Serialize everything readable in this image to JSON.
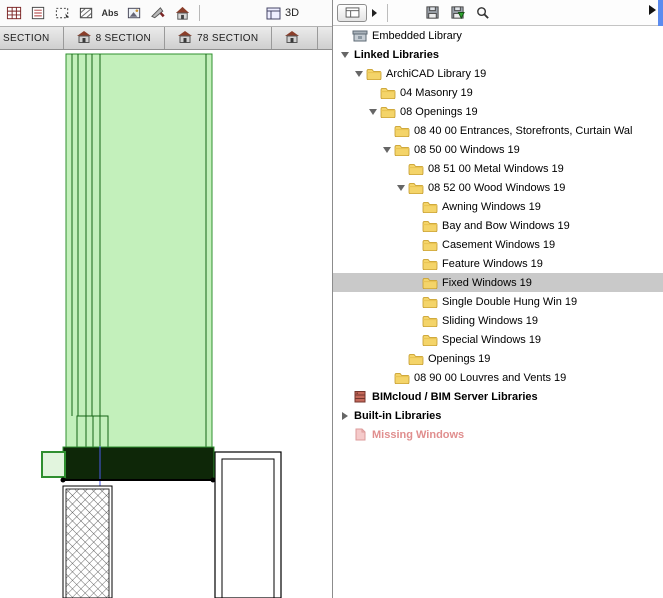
{
  "toolbar": {
    "icons": [
      {
        "name": "schedule-icon",
        "glyph": "schedule"
      },
      {
        "name": "project-index-icon",
        "glyph": "index"
      },
      {
        "name": "marquee-icon",
        "glyph": "marquee"
      },
      {
        "name": "fill-icon",
        "glyph": "fill"
      },
      {
        "name": "dimension-abs-icon",
        "glyph": "abs",
        "label": "Abs"
      },
      {
        "name": "figure-icon",
        "glyph": "figure"
      },
      {
        "name": "split-knife-icon",
        "glyph": "knife"
      },
      {
        "name": "elevation-tool-icon",
        "glyph": "house"
      }
    ],
    "view3d_label": "3D"
  },
  "tabs": [
    {
      "label": "SECTION",
      "icon": false
    },
    {
      "label": "8 SECTION",
      "icon": true
    },
    {
      "label": "78 SECTION",
      "icon": true
    },
    {
      "label": "",
      "icon": true
    }
  ],
  "library_panel": {
    "tree": {
      "selected_item": "Fixed Windows 19",
      "missing_color": "#e08e8e",
      "rows": [
        {
          "level": 0,
          "disclosure": null,
          "icon": "embedded",
          "label": "Embedded Library",
          "bold": false
        },
        {
          "level": 0,
          "disclosure": "open",
          "icon": null,
          "label": "Linked Libraries",
          "bold": true
        },
        {
          "level": 1,
          "disclosure": "open",
          "icon": "folder",
          "label": "ArchiCAD Library 19",
          "bold": false
        },
        {
          "level": 2,
          "disclosure": null,
          "icon": "folder",
          "label": "04 Masonry 19",
          "bold": false
        },
        {
          "level": 2,
          "disclosure": "open",
          "icon": "folder",
          "label": "08 Openings 19",
          "bold": false
        },
        {
          "level": 3,
          "disclosure": null,
          "icon": "folder",
          "label": "08 40 00 Entrances, Storefronts, Curtain Wal",
          "bold": false
        },
        {
          "level": 3,
          "disclosure": "open",
          "icon": "folder",
          "label": "08 50 00 Windows 19",
          "bold": false
        },
        {
          "level": 4,
          "disclosure": null,
          "icon": "folder",
          "label": "08 51 00 Metal Windows 19",
          "bold": false
        },
        {
          "level": 4,
          "disclosure": "open",
          "icon": "folder",
          "label": "08 52 00 Wood Windows 19",
          "bold": false
        },
        {
          "level": 5,
          "disclosure": null,
          "icon": "folder",
          "label": "Awning Windows 19",
          "bold": false
        },
        {
          "level": 5,
          "disclosure": null,
          "icon": "folder",
          "label": "Bay and Bow Windows 19",
          "bold": false
        },
        {
          "level": 5,
          "disclosure": null,
          "icon": "folder",
          "label": "Casement Windows 19",
          "bold": false
        },
        {
          "level": 5,
          "disclosure": null,
          "icon": "folder",
          "label": "Feature Windows 19",
          "bold": false
        },
        {
          "level": 5,
          "disclosure": null,
          "icon": "folder",
          "label": "Fixed Windows 19",
          "bold": false,
          "selected": true
        },
        {
          "level": 5,
          "disclosure": null,
          "icon": "folder",
          "label": "Single Double Hung Win 19",
          "bold": false
        },
        {
          "level": 5,
          "disclosure": null,
          "icon": "folder",
          "label": "Sliding Windows 19",
          "bold": false
        },
        {
          "level": 5,
          "disclosure": null,
          "icon": "folder",
          "label": "Special Windows 19",
          "bold": false
        },
        {
          "level": 4,
          "disclosure": null,
          "icon": "folder",
          "label": "Openings 19",
          "bold": false
        },
        {
          "level": 3,
          "disclosure": null,
          "icon": "folder",
          "label": "08 90 00 Louvres and Vents 19",
          "bold": false
        },
        {
          "level": 0,
          "disclosure": null,
          "icon": "server",
          "label": "BIMcloud / BIM Server Libraries",
          "bold": true
        },
        {
          "level": 0,
          "disclosure": "closed",
          "icon": null,
          "label": "Built-in Libraries",
          "bold": true
        },
        {
          "level": 0,
          "disclosure": null,
          "icon": "missing",
          "label": "Missing Windows",
          "bold": true,
          "color": "#e08e8e"
        }
      ]
    }
  }
}
